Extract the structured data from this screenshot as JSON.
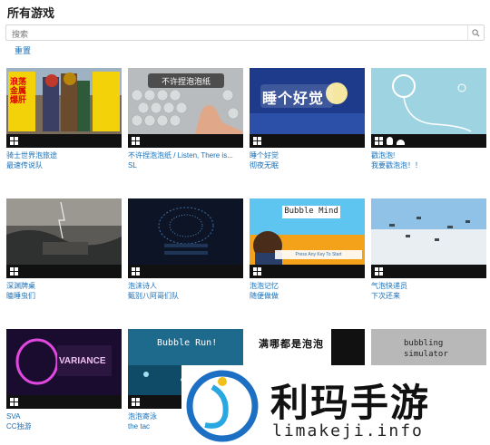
{
  "header": {
    "title": "所有游戏"
  },
  "search": {
    "placeholder": "搜索"
  },
  "filters": {
    "reset_label": "重置"
  },
  "cards": [
    {
      "title": "骑士世界泡旅途",
      "author": "最速传说队",
      "thumb_text": "浪荡金属 爆肝",
      "platforms": [
        "windows"
      ]
    },
    {
      "title": "不许捏泡泡纸 / Listen, There is...",
      "author": "SL",
      "thumb_text": "不许捏泡泡纸",
      "platforms": [
        "windows"
      ]
    },
    {
      "title": "睡个好觉",
      "author": "彻夜无眠",
      "thumb_text": "睡个好觉",
      "platforms": [
        "windows"
      ]
    },
    {
      "title": "戳泡泡!",
      "author": "我要戳泡泡！！",
      "thumb_text": "",
      "platforms": [
        "windows",
        "linux",
        "android"
      ]
    },
    {
      "title": "深渊牌桌",
      "author": "瞌睡虫们",
      "thumb_text": "",
      "platforms": [
        "windows"
      ]
    },
    {
      "title": "泡沫诗人",
      "author": "甄别八阿哥们队",
      "thumb_text": "",
      "platforms": [
        "windows"
      ]
    },
    {
      "title": "泡泡记忆",
      "author": "随便做做",
      "thumb_text": "Bubble Mind",
      "thumb_subtext": "Press Any Key To Start",
      "platforms": [
        "windows"
      ]
    },
    {
      "title": "气泡快递员",
      "author": "下次还来",
      "thumb_text": "",
      "platforms": [
        "windows"
      ]
    },
    {
      "title": "SVA",
      "author": "CC独游",
      "thumb_text": "VARIANCE",
      "platforms": [
        "windows"
      ]
    },
    {
      "title": "泡泡寄泳",
      "author": "the tac",
      "thumb_text": "Bubble Run!",
      "platforms": [
        "windows"
      ]
    },
    {
      "title": "",
      "author": "",
      "thumb_text": "满哪都是泡泡",
      "platforms": []
    },
    {
      "title": "",
      "author": "",
      "thumb_text": "bubbling simulator",
      "platforms": []
    }
  ],
  "watermark": {
    "brand": "利玛手游",
    "domain": "limakeji.info"
  }
}
